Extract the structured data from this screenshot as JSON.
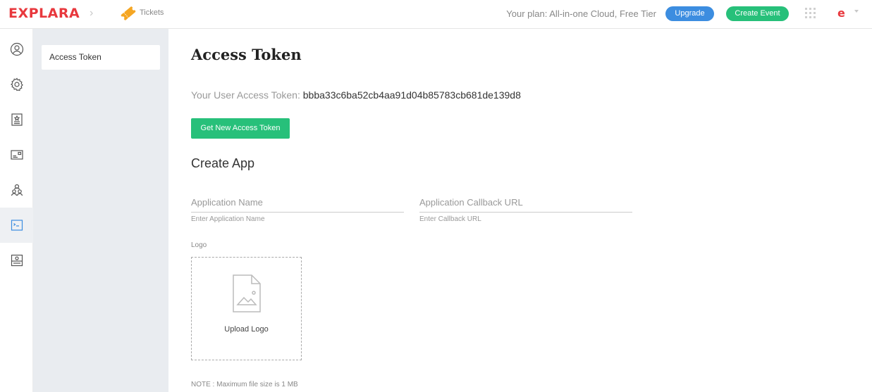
{
  "header": {
    "brand": "EXPLARA",
    "breadcrumb_label": "Tickets",
    "plan_text": "Your plan: All-in-one Cloud, Free Tier",
    "upgrade_label": "Upgrade",
    "create_event_label": "Create Event",
    "user_initial": "e",
    "colors": {
      "brand": "#e8383d",
      "upgrade": "#3c8de0",
      "create": "#27c07a"
    }
  },
  "rail": {
    "items": [
      {
        "icon": "user-circle-icon",
        "active": false
      },
      {
        "icon": "gear-icon",
        "active": false
      },
      {
        "icon": "badge-star-icon",
        "active": false
      },
      {
        "icon": "card-icon",
        "active": false
      },
      {
        "icon": "users-icon",
        "active": false
      },
      {
        "icon": "terminal-icon",
        "active": true
      },
      {
        "icon": "device-icon",
        "active": false
      }
    ]
  },
  "subnav": {
    "items": [
      {
        "label": "Access Token",
        "active": true
      }
    ]
  },
  "main": {
    "title": "Access Token",
    "token_label": "Your User Access Token:",
    "token_value": "bbba33c6ba52cb4aa91d04b85783cb681de139d8",
    "get_token_label": "Get New Access Token",
    "create_app_title": "Create App",
    "fields": {
      "app_name": {
        "label": "Application Name",
        "help": "Enter Application Name"
      },
      "callback": {
        "label": "Application Callback URL",
        "help": "Enter Callback URL"
      }
    },
    "logo_label": "Logo",
    "upload_label": "Upload Logo",
    "note": "NOTE : Maximum file size is 1 MB"
  }
}
